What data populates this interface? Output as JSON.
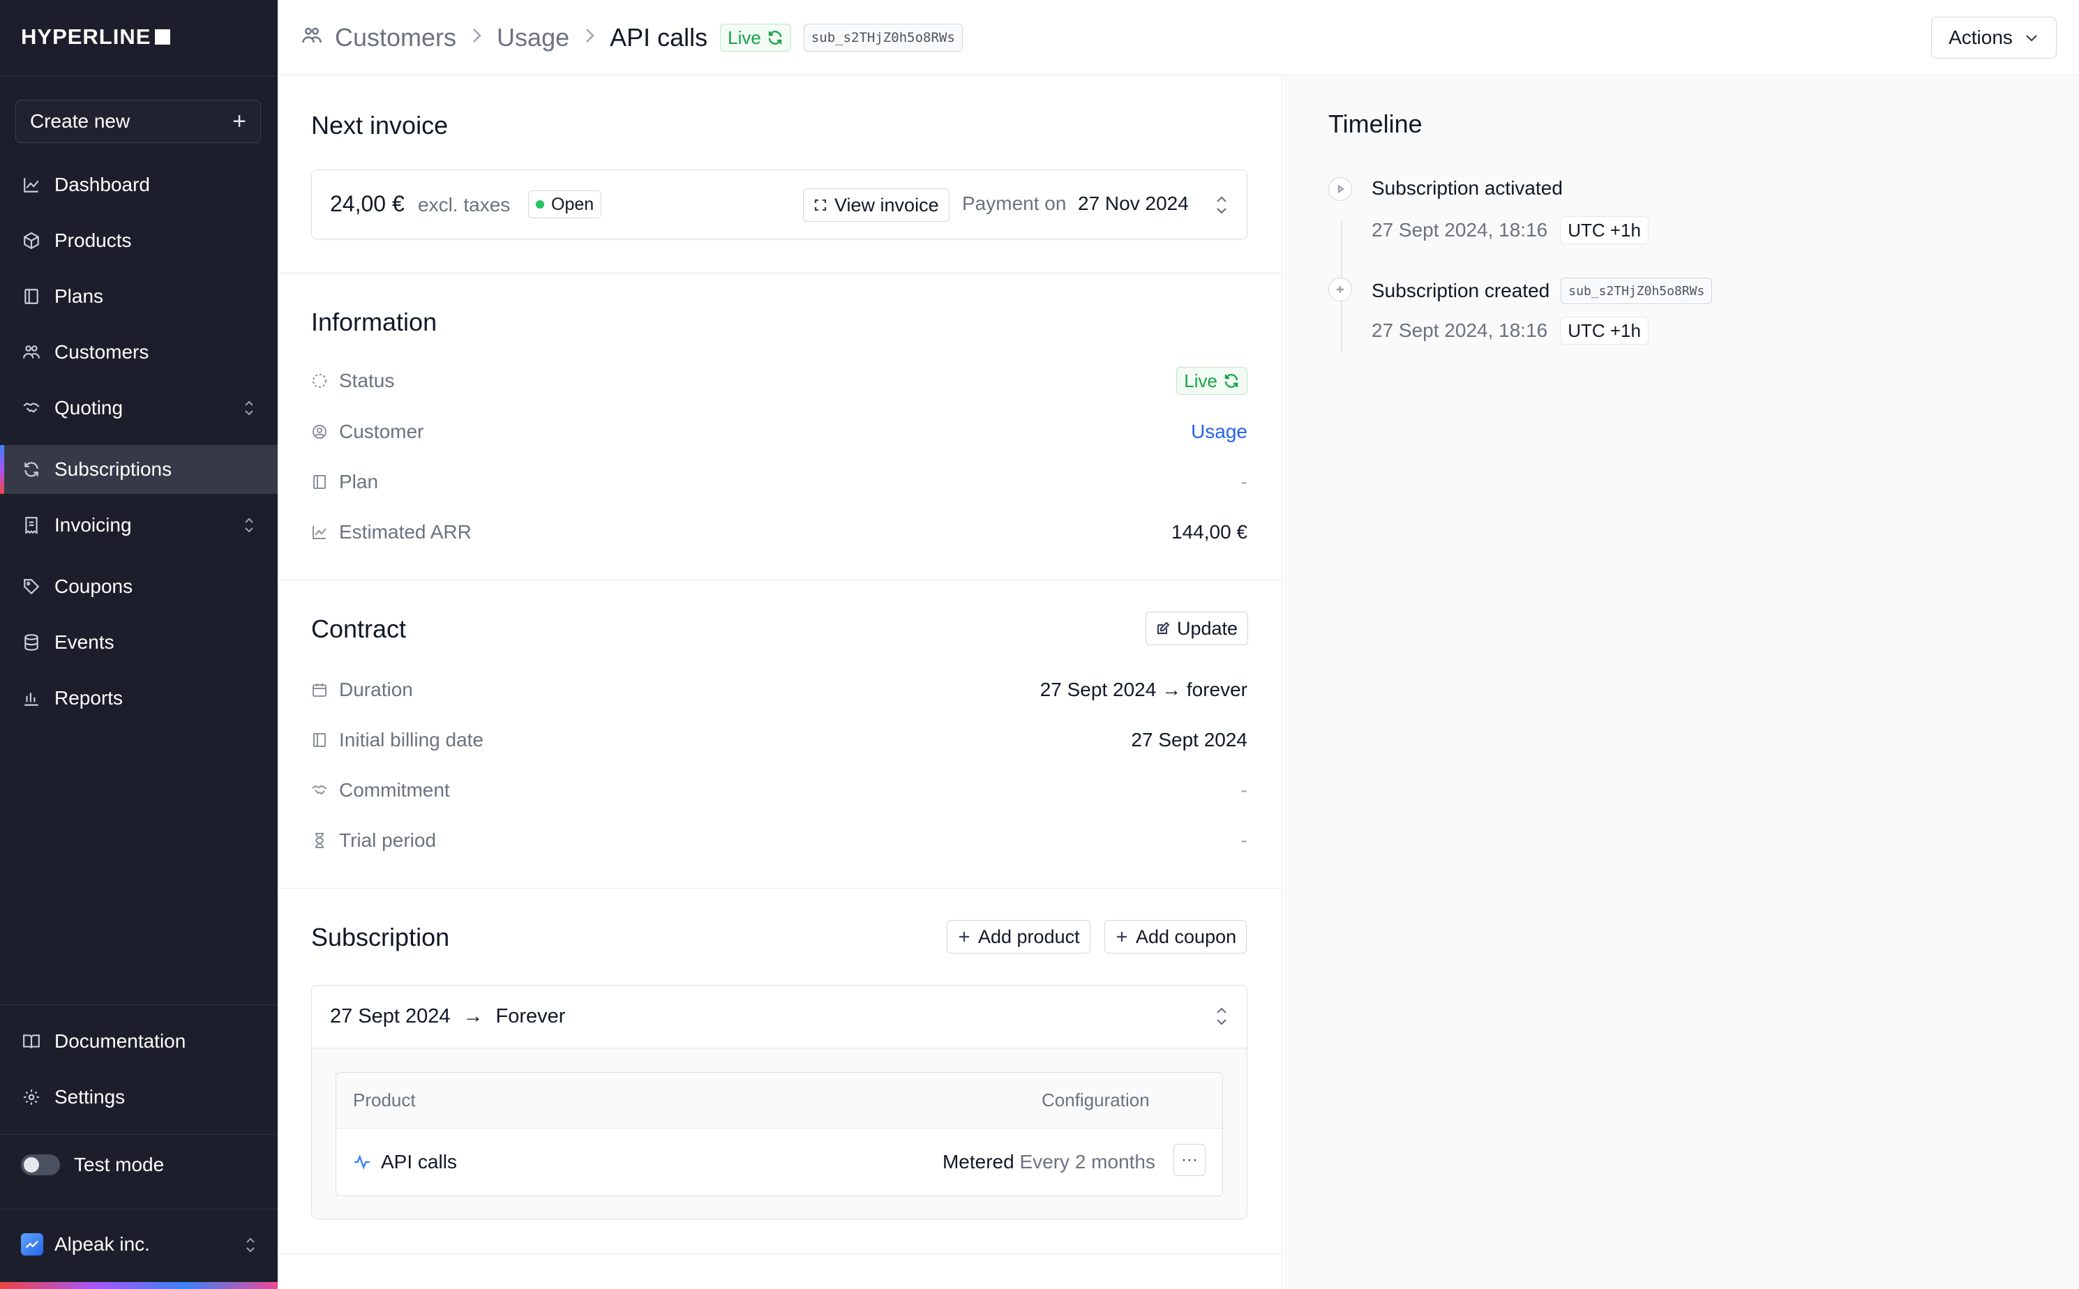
{
  "app": {
    "logo": "HYPERLINE"
  },
  "sidebar": {
    "create_new": "Create new",
    "items": [
      {
        "label": "Dashboard",
        "icon": "chart-line-icon"
      },
      {
        "label": "Products",
        "icon": "box-icon"
      },
      {
        "label": "Plans",
        "icon": "book-icon"
      },
      {
        "label": "Customers",
        "icon": "users-icon"
      },
      {
        "label": "Quoting",
        "icon": "handshake-icon",
        "expandable": true
      },
      {
        "label": "Subscriptions",
        "icon": "refresh-icon",
        "active": true
      },
      {
        "label": "Invoicing",
        "icon": "receipt-icon",
        "expandable": true
      },
      {
        "label": "Coupons",
        "icon": "tag-icon"
      },
      {
        "label": "Events",
        "icon": "database-icon"
      },
      {
        "label": "Reports",
        "icon": "bar-chart-icon"
      }
    ],
    "bottom_items": [
      {
        "label": "Documentation",
        "icon": "book-open-icon"
      },
      {
        "label": "Settings",
        "icon": "gear-icon"
      }
    ],
    "test_mode": {
      "label": "Test mode",
      "enabled": false
    },
    "organization": "Alpeak inc."
  },
  "header": {
    "breadcrumb": [
      "Customers",
      "Usage",
      "API calls"
    ],
    "status": "Live",
    "subscription_id": "sub_s2THjZ0h5o8RWs",
    "actions_label": "Actions"
  },
  "next_invoice": {
    "title": "Next invoice",
    "amount": "24,00 €",
    "taxes_note": "excl. taxes",
    "status": "Open",
    "view_label": "View invoice",
    "payment_label": "Payment on",
    "payment_date": "27 Nov 2024"
  },
  "information": {
    "title": "Information",
    "rows": [
      {
        "label": "Status",
        "value": "Live",
        "icon": "status-icon"
      },
      {
        "label": "Customer",
        "value": "Usage",
        "icon": "user-circle-icon"
      },
      {
        "label": "Plan",
        "value": "-",
        "icon": "book-icon"
      },
      {
        "label": "Estimated ARR",
        "value": "144,00 €",
        "icon": "chart-line-icon"
      }
    ]
  },
  "contract": {
    "title": "Contract",
    "update_label": "Update",
    "rows": [
      {
        "label": "Duration",
        "value": "27 Sept 2024 → forever",
        "icon": "calendar-icon"
      },
      {
        "label": "Initial billing date",
        "value": "27 Sept 2024",
        "icon": "book-icon"
      },
      {
        "label": "Commitment",
        "value": "-",
        "icon": "handshake-icon"
      },
      {
        "label": "Trial period",
        "value": "-",
        "icon": "hourglass-icon"
      }
    ]
  },
  "subscription": {
    "title": "Subscription",
    "add_product_label": "Add product",
    "add_coupon_label": "Add coupon",
    "period_start": "27 Sept 2024",
    "period_end": "Forever",
    "columns": [
      "Product",
      "Configuration"
    ],
    "products": [
      {
        "name": "API calls",
        "config_type": "Metered",
        "config_interval": "Every 2 months"
      }
    ]
  },
  "timeline": {
    "title": "Timeline",
    "events": [
      {
        "title": "Subscription activated",
        "date": "27 Sept 2024, 18:16",
        "tz": "UTC +1h",
        "badge": ""
      },
      {
        "title": "Subscription created",
        "date": "27 Sept 2024, 18:16",
        "tz": "UTC +1h",
        "badge": "sub_s2THjZ0h5o8RWs"
      }
    ]
  }
}
